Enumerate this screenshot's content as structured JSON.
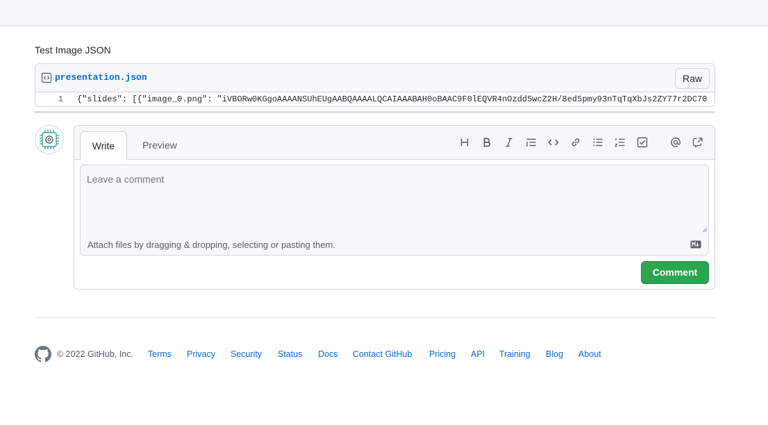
{
  "section": {
    "title": "Test Image JSON"
  },
  "file": {
    "name": "presentation.json",
    "raw_label": "Raw",
    "lines": [
      {
        "number": "1",
        "code": "{\"slides\": [{\"image_0.png\": \"iVBORw0KGgoAAAANSUhEUgAABQAAAALQCAIAAABAH0oBAAC9F0lEQVR4nOzdd5wcZ2H/8ed5pmy93nTqTqXbJs2ZY77r2DC70"
      }
    ]
  },
  "comment": {
    "tabs": [
      {
        "label": "Write"
      },
      {
        "label": "Preview"
      }
    ],
    "toolbar_icons": [
      "heading-icon",
      "bold-icon",
      "italic-icon",
      "quote-icon",
      "code-icon",
      "link-icon",
      "bulleted-list-icon",
      "numbered-list-icon",
      "task-list-icon",
      "mention-icon",
      "reference-icon"
    ],
    "placeholder": "Leave a comment",
    "attach_text": "Attach files by dragging & dropping, selecting or pasting them.",
    "submit_label": "Comment",
    "submit_color": "#2da44e"
  },
  "footer": {
    "copyright": "© 2022 GitHub, Inc.",
    "links": [
      {
        "label": "Terms"
      },
      {
        "label": "Privacy"
      },
      {
        "label": "Security"
      },
      {
        "label": "Status"
      },
      {
        "label": "Docs"
      },
      {
        "label": "Contact GitHub"
      },
      {
        "label": "Pricing"
      },
      {
        "label": "API"
      },
      {
        "label": "Training"
      },
      {
        "label": "Blog"
      },
      {
        "label": "About"
      }
    ]
  }
}
